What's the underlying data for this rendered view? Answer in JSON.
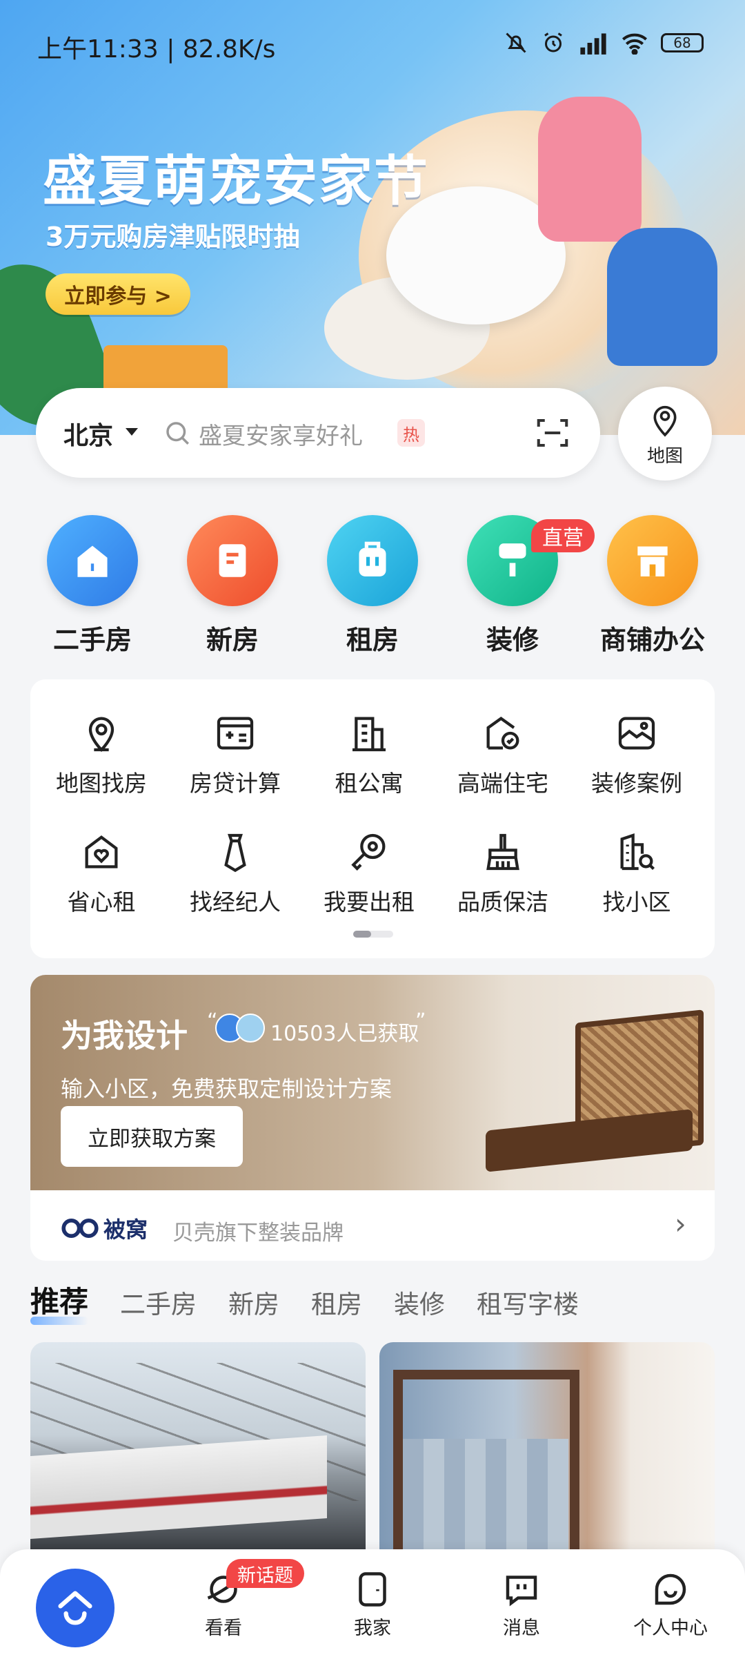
{
  "status_bar": {
    "time": "上午11:33 | 82.8K/s",
    "battery": "68"
  },
  "banner": {
    "title": "盛夏萌宠安家节",
    "subtitle": "3万元购房津贴限时抽",
    "cta": "立即参与 >"
  },
  "search": {
    "city": "北京",
    "placeholder": "盛夏安家享好礼",
    "hot_tag": "热",
    "map_label": "地图"
  },
  "categories": [
    {
      "label": "二手房",
      "color": "#3d8ff2"
    },
    {
      "label": "新房",
      "color": "#f5663e"
    },
    {
      "label": "租房",
      "color": "#22b3e0"
    },
    {
      "label": "装修",
      "color": "#14c59a",
      "badge": "直营"
    },
    {
      "label": "商铺办公",
      "color": "#f7a21b"
    }
  ],
  "tools": [
    {
      "label": "地图找房",
      "icon": "map-pin-icon"
    },
    {
      "label": "房贷计算",
      "icon": "calculator-icon"
    },
    {
      "label": "租公寓",
      "icon": "apartment-icon"
    },
    {
      "label": "高端住宅",
      "icon": "premium-house-icon"
    },
    {
      "label": "装修案例",
      "icon": "picture-icon"
    },
    {
      "label": "省心租",
      "icon": "heart-house-icon"
    },
    {
      "label": "找经纪人",
      "icon": "agent-tie-icon"
    },
    {
      "label": "我要出租",
      "icon": "key-icon"
    },
    {
      "label": "品质保洁",
      "icon": "broom-icon"
    },
    {
      "label": "找小区",
      "icon": "building-search-icon"
    }
  ],
  "design_card": {
    "title": "为我设计",
    "quote_open": "“",
    "count_text": "10503人已获取",
    "quote_close": "”",
    "subtitle": "输入小区，免费获取定制设计方案",
    "button": "立即获取方案",
    "brand_name": "被窝",
    "brand_tagline": "贝壳旗下整装品牌"
  },
  "feed_tabs": [
    "推荐",
    "二手房",
    "新房",
    "租房",
    "装修",
    "租写字楼"
  ],
  "bottom_nav": {
    "items": [
      {
        "label": "看看",
        "badge": "新话题"
      },
      {
        "label": "我家"
      },
      {
        "label": "消息"
      },
      {
        "label": "个人中心"
      }
    ]
  },
  "colors": {
    "accent": "#2a62e8",
    "badge_red": "#f24646",
    "page_bg": "#f4f5f7"
  }
}
